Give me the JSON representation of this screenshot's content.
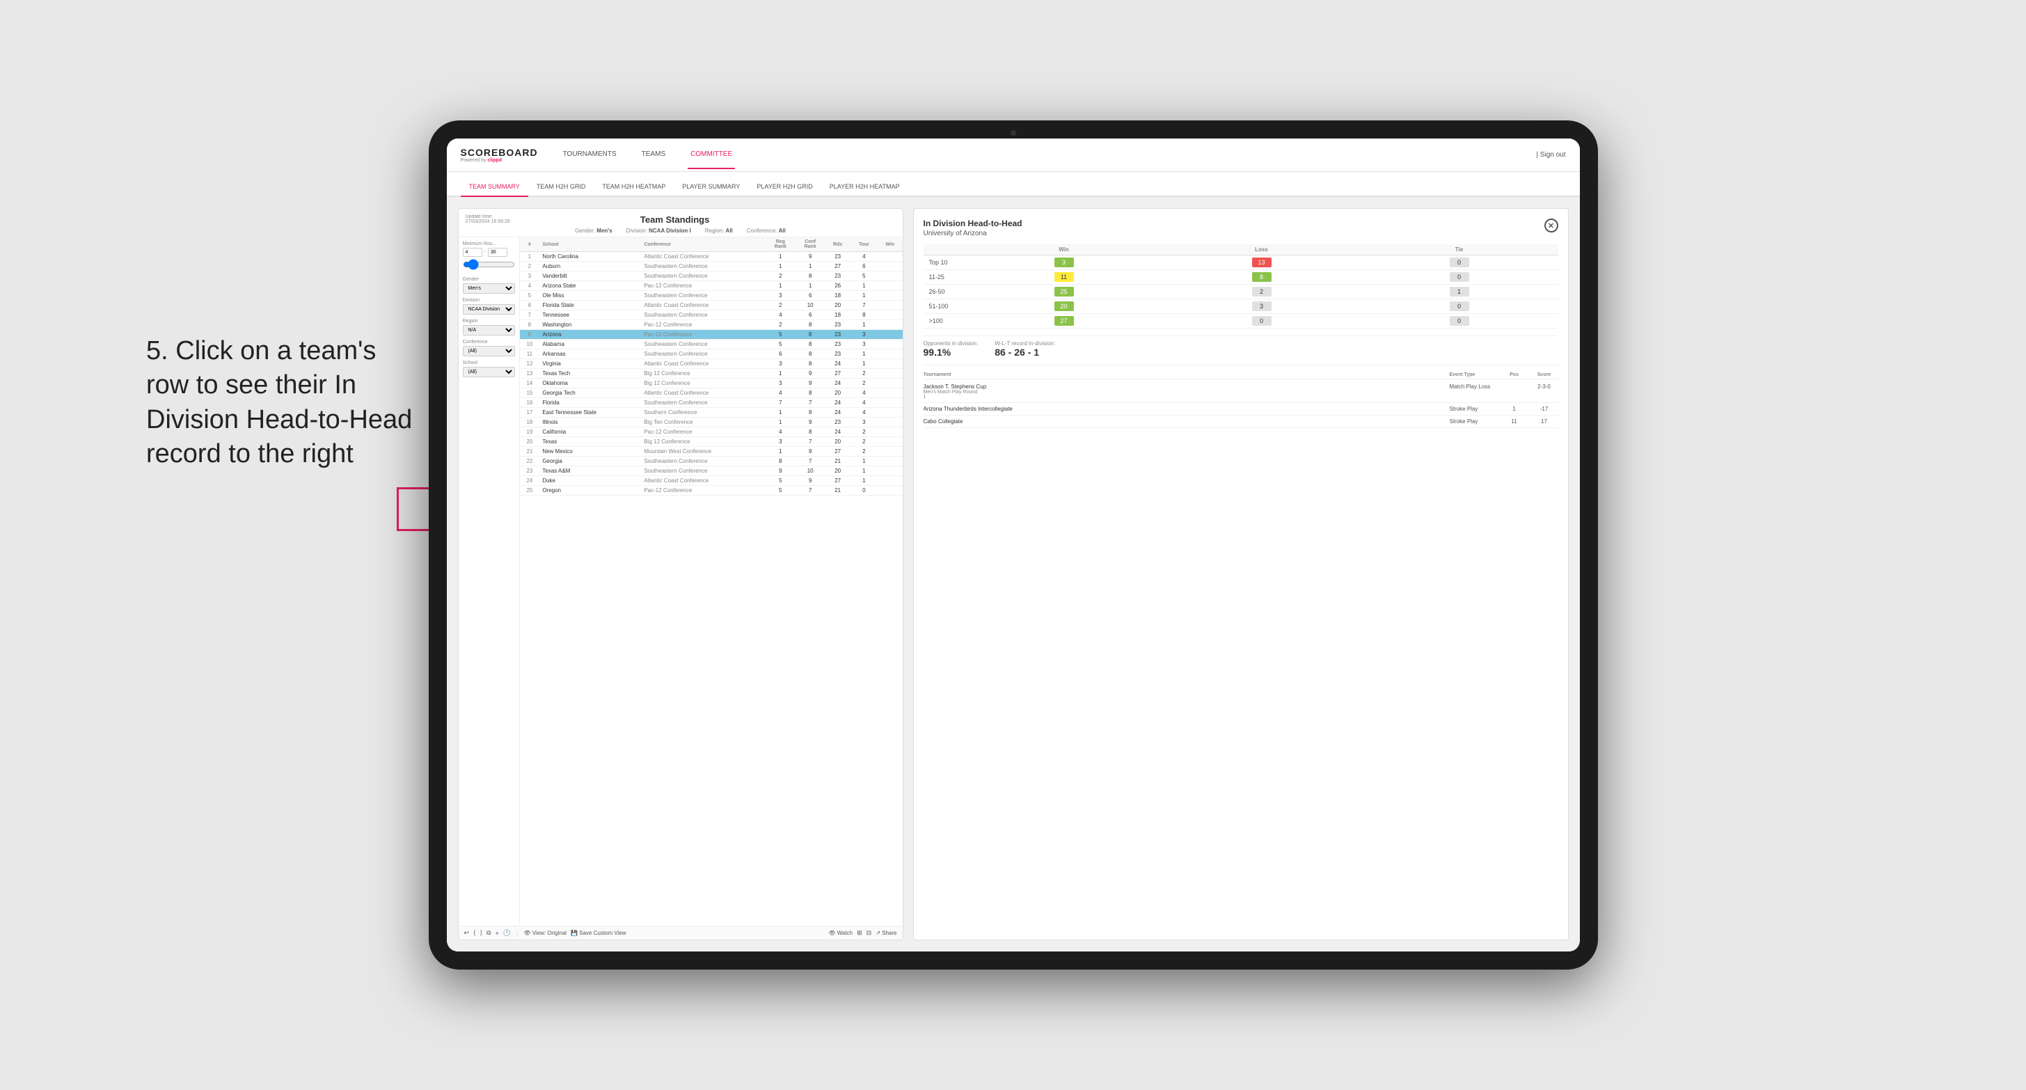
{
  "app": {
    "logo": "SCOREBOARD",
    "powered_by": "Powered by clippd",
    "sign_out": "Sign out"
  },
  "top_nav": {
    "links": [
      {
        "label": "TOURNAMENTS",
        "active": false
      },
      {
        "label": "TEAMS",
        "active": false
      },
      {
        "label": "COMMITTEE",
        "active": true
      }
    ]
  },
  "sub_nav": {
    "links": [
      {
        "label": "TEAM SUMMARY",
        "active": true
      },
      {
        "label": "TEAM H2H GRID",
        "active": false
      },
      {
        "label": "TEAM H2H HEATMAP",
        "active": false
      },
      {
        "label": "PLAYER SUMMARY",
        "active": false
      },
      {
        "label": "PLAYER H2H GRID",
        "active": false
      },
      {
        "label": "PLAYER H2H HEATMAP",
        "active": false
      }
    ]
  },
  "annotation": {
    "text": "5. Click on a team's row to see their In Division Head-to-Head record to the right"
  },
  "panel": {
    "title": "Team Standings",
    "update_time": "Update time:",
    "update_datetime": "27/03/2024 16:56:26",
    "gender_label": "Gender:",
    "gender_value": "Men's",
    "division_label": "Division:",
    "division_value": "NCAA Division I",
    "region_label": "Region:",
    "region_value": "All",
    "conference_label": "Conference:",
    "conference_value": "All"
  },
  "filters": {
    "min_rounds_label": "Minimum Rou...",
    "min_rounds_value": "4",
    "max_rounds_value": "30",
    "gender_label": "Gender",
    "gender_value": "Men's",
    "division_label": "Division",
    "division_value": "NCAA Division I",
    "region_label": "Region",
    "region_value": "N/A",
    "conference_label": "Conference",
    "conference_value": "(All)",
    "school_label": "School",
    "school_value": "(All)"
  },
  "table": {
    "headers": [
      "#",
      "School",
      "Conference",
      "Reg Rank",
      "Conf Rank",
      "Rds",
      "Tour",
      "Win"
    ],
    "rows": [
      {
        "rank": "1",
        "school": "North Carolina",
        "conference": "Atlantic Coast Conference",
        "reg": "1",
        "conf": "9",
        "rds": "23",
        "tour": "4",
        "win": ""
      },
      {
        "rank": "2",
        "school": "Auburn",
        "conference": "Southeastern Conference",
        "reg": "1",
        "conf": "1",
        "rds": "27",
        "tour": "6",
        "win": ""
      },
      {
        "rank": "3",
        "school": "Vanderbilt",
        "conference": "Southeastern Conference",
        "reg": "2",
        "conf": "8",
        "rds": "23",
        "tour": "5",
        "win": ""
      },
      {
        "rank": "4",
        "school": "Arizona State",
        "conference": "Pac-12 Conference",
        "reg": "1",
        "conf": "1",
        "rds": "26",
        "tour": "1",
        "win": ""
      },
      {
        "rank": "5",
        "school": "Ole Miss",
        "conference": "Southeastern Conference",
        "reg": "3",
        "conf": "6",
        "rds": "18",
        "tour": "1",
        "win": ""
      },
      {
        "rank": "6",
        "school": "Florida State",
        "conference": "Atlantic Coast Conference",
        "reg": "2",
        "conf": "10",
        "rds": "20",
        "tour": "7",
        "win": ""
      },
      {
        "rank": "7",
        "school": "Tennessee",
        "conference": "Southeastern Conference",
        "reg": "4",
        "conf": "6",
        "rds": "18",
        "tour": "8",
        "win": ""
      },
      {
        "rank": "8",
        "school": "Washington",
        "conference": "Pac-12 Conference",
        "reg": "2",
        "conf": "8",
        "rds": "23",
        "tour": "1",
        "win": ""
      },
      {
        "rank": "9",
        "school": "Arizona",
        "conference": "Pac-12 Conference",
        "reg": "5",
        "conf": "8",
        "rds": "23",
        "tour": "3",
        "win": "",
        "selected": true
      },
      {
        "rank": "10",
        "school": "Alabama",
        "conference": "Southeastern Conference",
        "reg": "5",
        "conf": "8",
        "rds": "23",
        "tour": "3",
        "win": ""
      },
      {
        "rank": "11",
        "school": "Arkansas",
        "conference": "Southeastern Conference",
        "reg": "6",
        "conf": "8",
        "rds": "23",
        "tour": "1",
        "win": ""
      },
      {
        "rank": "12",
        "school": "Virginia",
        "conference": "Atlantic Coast Conference",
        "reg": "3",
        "conf": "8",
        "rds": "24",
        "tour": "1",
        "win": ""
      },
      {
        "rank": "13",
        "school": "Texas Tech",
        "conference": "Big 12 Conference",
        "reg": "1",
        "conf": "9",
        "rds": "27",
        "tour": "2",
        "win": ""
      },
      {
        "rank": "14",
        "school": "Oklahoma",
        "conference": "Big 12 Conference",
        "reg": "3",
        "conf": "9",
        "rds": "24",
        "tour": "2",
        "win": ""
      },
      {
        "rank": "15",
        "school": "Georgia Tech",
        "conference": "Atlantic Coast Conference",
        "reg": "4",
        "conf": "8",
        "rds": "20",
        "tour": "4",
        "win": ""
      },
      {
        "rank": "16",
        "school": "Florida",
        "conference": "Southeastern Conference",
        "reg": "7",
        "conf": "7",
        "rds": "24",
        "tour": "4",
        "win": ""
      },
      {
        "rank": "17",
        "school": "East Tennessee State",
        "conference": "Southern Conference",
        "reg": "1",
        "conf": "8",
        "rds": "24",
        "tour": "4",
        "win": ""
      },
      {
        "rank": "18",
        "school": "Illinois",
        "conference": "Big Ten Conference",
        "reg": "1",
        "conf": "9",
        "rds": "23",
        "tour": "3",
        "win": ""
      },
      {
        "rank": "19",
        "school": "California",
        "conference": "Pac-12 Conference",
        "reg": "4",
        "conf": "8",
        "rds": "24",
        "tour": "2",
        "win": ""
      },
      {
        "rank": "20",
        "school": "Texas",
        "conference": "Big 12 Conference",
        "reg": "3",
        "conf": "7",
        "rds": "20",
        "tour": "2",
        "win": ""
      },
      {
        "rank": "21",
        "school": "New Mexico",
        "conference": "Mountain West Conference",
        "reg": "1",
        "conf": "9",
        "rds": "27",
        "tour": "2",
        "win": ""
      },
      {
        "rank": "22",
        "school": "Georgia",
        "conference": "Southeastern Conference",
        "reg": "8",
        "conf": "7",
        "rds": "21",
        "tour": "1",
        "win": ""
      },
      {
        "rank": "23",
        "school": "Texas A&M",
        "conference": "Southeastern Conference",
        "reg": "9",
        "conf": "10",
        "rds": "20",
        "tour": "1",
        "win": ""
      },
      {
        "rank": "24",
        "school": "Duke",
        "conference": "Atlantic Coast Conference",
        "reg": "5",
        "conf": "9",
        "rds": "27",
        "tour": "1",
        "win": ""
      },
      {
        "rank": "25",
        "school": "Oregon",
        "conference": "Pac-12 Conference",
        "reg": "5",
        "conf": "7",
        "rds": "21",
        "tour": "0",
        "win": ""
      }
    ]
  },
  "h2h": {
    "title": "In Division Head-to-Head",
    "team": "University of Arizona",
    "ranges": [
      {
        "label": "Top 10",
        "win": "3",
        "loss": "13",
        "tie": "0",
        "win_color": "#8bc34a",
        "loss_color": "#ef5350",
        "tie_color": "#e0e0e0"
      },
      {
        "label": "11-25",
        "win": "11",
        "loss": "8",
        "tie": "0",
        "win_color": "#ffeb3b",
        "loss_color": "#8bc34a",
        "tie_color": "#e0e0e0"
      },
      {
        "label": "26-50",
        "win": "25",
        "loss": "2",
        "tie": "1",
        "win_color": "#8bc34a",
        "loss_color": "#e0e0e0",
        "tie_color": "#e0e0e0"
      },
      {
        "label": "51-100",
        "win": "20",
        "loss": "3",
        "tie": "0",
        "win_color": "#8bc34a",
        "loss_color": "#e0e0e0",
        "tie_color": "#e0e0e0"
      },
      {
        "label": ">100",
        "win": "27",
        "loss": "0",
        "tie": "0",
        "win_color": "#8bc34a",
        "loss_color": "#e0e0e0",
        "tie_color": "#e0e0e0"
      }
    ],
    "opponents_label": "Opponents in division:",
    "opponents_value": "99.1%",
    "record_label": "W-L-T record in-division:",
    "record_value": "86 - 26 - 1",
    "tournaments": [
      {
        "name": "Jackson T. Stephens Cup",
        "sub": "Men's Match Play Round",
        "event": "Match Play",
        "result": "Loss",
        "pos": "",
        "score": "2-3-0",
        "detail": "1"
      },
      {
        "name": "Arizona Thunderbirds Intercollegiate",
        "sub": "",
        "event": "Stroke Play",
        "result": "",
        "pos": "1",
        "score": "-17"
      },
      {
        "name": "Cabo Collegiate",
        "sub": "",
        "event": "Stroke Play",
        "result": "",
        "pos": "11",
        "score": "17"
      }
    ]
  },
  "toolbar": {
    "undo": "↩",
    "redo": "↪",
    "view_original": "View: Original",
    "save_custom": "Save Custom View",
    "watch": "Watch",
    "share": "Share"
  }
}
